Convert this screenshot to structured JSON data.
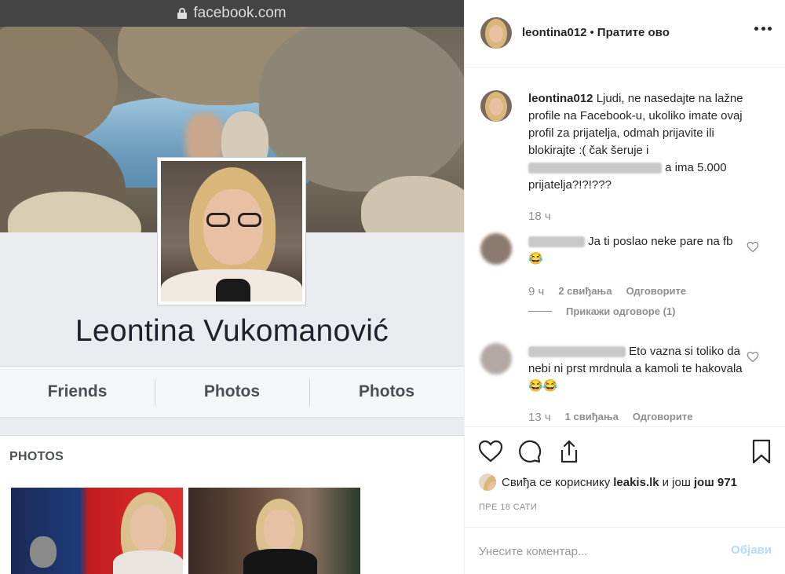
{
  "browser": {
    "url": "facebook.com"
  },
  "facebook": {
    "profile_name": "Leontina Vukomanović",
    "tabs": [
      "Friends",
      "Photos",
      "Photos"
    ],
    "photos_heading": "PHOTOS"
  },
  "post_header": {
    "username": "leontina012",
    "separator": "•",
    "follow_label": "Пратите ово"
  },
  "caption": {
    "username": "leontina012",
    "text_before_blur": "Ljudi, ne nasedajte na lažne profile na Facebook-u, ukoliko imate ovaj profil za prijatelja, odmah prijavite ili blokirajte :( čak šeruje i",
    "text_after_blur": "a ima 5.000 prijatelja?!?!???",
    "time": "18 ч"
  },
  "comments": [
    {
      "text": "Ja ti poslao neke pare na fb😂",
      "time": "9 ч",
      "likes": "2 свиђања",
      "reply": "Одговорите",
      "view_replies": "Прикажи одговоре (1)"
    },
    {
      "text": "Eto vazna si toliko da nebi ni prst mrdnula a kamoli te hakovala 😂😂",
      "time": "13 ч",
      "likes": "1 свиђања",
      "reply": "Одговорите"
    }
  ],
  "likes_line": {
    "prefix": "Свиђа се кориснику",
    "user": "leakis.lk",
    "middle": "и још",
    "count": "још 971"
  },
  "date": "ПРЕ 18 САТИ",
  "add_comment": {
    "placeholder": "Унесите коментар...",
    "post_label": "Објави"
  },
  "icons": [
    "lock-icon",
    "more-icon",
    "heart-icon",
    "comment-icon",
    "share-icon",
    "bookmark-icon"
  ]
}
